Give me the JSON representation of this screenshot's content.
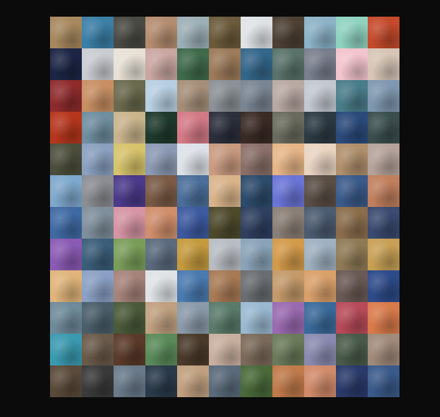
{
  "background_color": "#0b0b0b",
  "mosaic": {
    "tiles": [
      [
        "#a7885e",
        "#3b7fa6",
        "#4a4a44",
        "#b48c70",
        "#9cafb6",
        "#6b5a3b",
        "#dfe3e6",
        "#4d4034",
        "#8bb2c6",
        "#8fd2c0",
        "#c44a2b"
      ],
      [
        "#1c2545",
        "#c9ccd1",
        "#e7e1d6",
        "#c9a6a0",
        "#3f6a4b",
        "#9c7a5a",
        "#34668a",
        "#59726a",
        "#7a7f8d",
        "#f3c4cd",
        "#d7c5b6"
      ],
      [
        "#8f2b2d",
        "#c88f63",
        "#6a6a4e",
        "#b7cfe2",
        "#a68f7a",
        "#8b9196",
        "#7a8593",
        "#b9a9a3",
        "#c3c8d0",
        "#4a7d8a",
        "#7f98b0"
      ],
      [
        "#b6361d",
        "#6f8ea0",
        "#c9b48c",
        "#1f3a2d",
        "#d47a86",
        "#2b2f3b",
        "#3a2b25",
        "#6a6b5e",
        "#2d3a43",
        "#2a4a7b",
        "#3b4e4e"
      ],
      [
        "#4d4f3c",
        "#8aa0c0",
        "#d6c36a",
        "#8c9ab4",
        "#dde2e8",
        "#c99a80",
        "#8a6f68",
        "#e7b688",
        "#e9d4c2",
        "#b08f6c",
        "#b5a39b"
      ],
      [
        "#7ea8cc",
        "#8a8d92",
        "#4b3a8a",
        "#7a5a45",
        "#4b6e9a",
        "#d9b48a",
        "#2d4b6b",
        "#6a74d6",
        "#5a4e45",
        "#3a5a8a",
        "#c17f5e"
      ],
      [
        "#3f6aa4",
        "#7f8f9b",
        "#d694a4",
        "#d08e6c",
        "#3d5aa0",
        "#4d4a2c",
        "#2f3f5f",
        "#8a7f76",
        "#4b5b70",
        "#8a6d4c",
        "#3a4a70"
      ],
      [
        "#8a5ab4",
        "#3b5e7a",
        "#7a9e5a",
        "#5b6b7d",
        "#c49a3e",
        "#b8bdc3",
        "#8aa3b8",
        "#d39a4a",
        "#9fb0c0",
        "#8e7a55",
        "#c7a055"
      ],
      [
        "#e0b47a",
        "#8aa0c4",
        "#a6837a",
        "#dfe3e6",
        "#4a7ab0",
        "#a87a55",
        "#6a6e72",
        "#c49a6a",
        "#d9a06a",
        "#6a5a55",
        "#2d4b8a"
      ],
      [
        "#6f8a9a",
        "#4a5e6a",
        "#4a5a3a",
        "#c0a080",
        "#8a9aa8",
        "#5a7a6a",
        "#9ab8d0",
        "#9a6ab0",
        "#3a6a9a",
        "#b84a5a",
        "#d87a4a"
      ],
      [
        "#3a9ab0",
        "#6a5a4a",
        "#5a3a2a",
        "#5a8a5a",
        "#4a3a2a",
        "#c8b0a0",
        "#7a6a5a",
        "#6a7a5a",
        "#8a8ab0",
        "#4a5a4a",
        "#a08a7a"
      ],
      [
        "#5a4a3a",
        "#3a3a3a",
        "#6a7a8a",
        "#2a3a4a",
        "#c0a080",
        "#5a6a7a",
        "#4a6a3a",
        "#c07a4a",
        "#d08a6a",
        "#2a3a6a",
        "#3a5a8a"
      ]
    ]
  }
}
